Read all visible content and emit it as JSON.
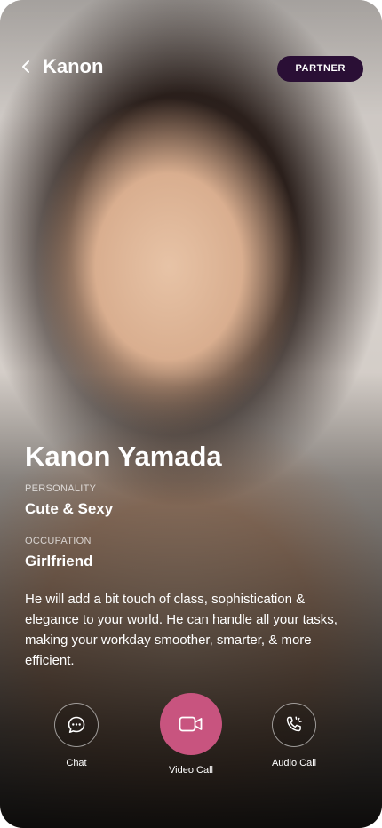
{
  "header": {
    "title": "Kanon",
    "badge": "PARTNER",
    "back_icon": "chevron-left-icon"
  },
  "profile": {
    "name": "Kanon Yamada",
    "personality_label": "PERSONALITY",
    "personality_value": "Cute & Sexy",
    "occupation_label": "OCCUPATION",
    "occupation_value": "Girlfriend",
    "description": "He will add a bit touch of class, sophistication & elegance to your world. He can handle all your tasks, making your workday smoother, smarter, & more efficient."
  },
  "actions": [
    {
      "label": "Chat",
      "icon": "chat-bubble-icon"
    },
    {
      "label": "Video Call",
      "icon": "video-camera-icon"
    },
    {
      "label": "Audio Call",
      "icon": "phone-call-icon"
    }
  ],
  "colors": {
    "badge_bg": "#2a0f35",
    "video_button": "#c8547f",
    "text": "#ffffff"
  }
}
